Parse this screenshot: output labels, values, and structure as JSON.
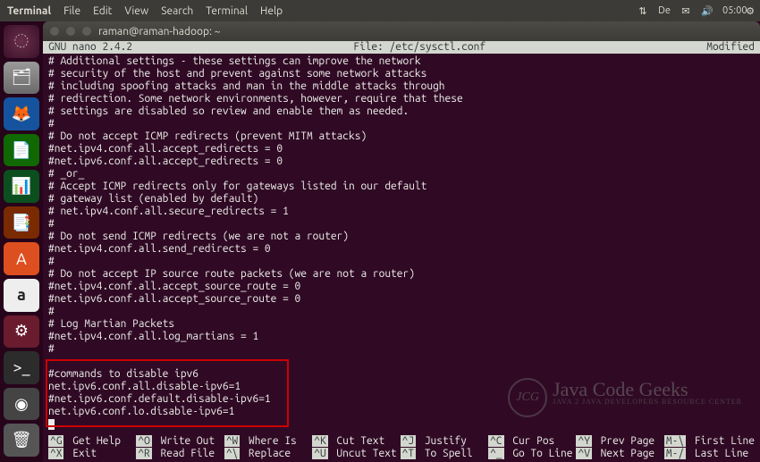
{
  "menubar": {
    "app": "Terminal",
    "items": [
      "File",
      "Edit",
      "View",
      "Search",
      "Terminal",
      "Help"
    ]
  },
  "tray": {
    "kbd": "De",
    "time": "05:00"
  },
  "window": {
    "title": "raman@raman-hadoop: ~"
  },
  "nano": {
    "version": "GNU nano 2.4.2",
    "file_label": "File: /etc/sysctl.conf",
    "status": "Modified"
  },
  "content_lines": [
    "# Additional settings - these settings can improve the network",
    "# security of the host and prevent against some network attacks",
    "# including spoofing attacks and man in the middle attacks through",
    "# redirection. Some network environments, however, require that these",
    "# settings are disabled so review and enable them as needed.",
    "#",
    "# Do not accept ICMP redirects (prevent MITM attacks)",
    "#net.ipv4.conf.all.accept_redirects = 0",
    "#net.ipv6.conf.all.accept_redirects = 0",
    "# _or_",
    "# Accept ICMP redirects only for gateways listed in our default",
    "# gateway list (enabled by default)",
    "# net.ipv4.conf.all.secure_redirects = 1",
    "#",
    "# Do not send ICMP redirects (we are not a router)",
    "#net.ipv4.conf.all.send_redirects = 0",
    "#",
    "# Do not accept IP source route packets (we are not a router)",
    "#net.ipv4.conf.all.accept_source_route = 0",
    "#net.ipv6.conf.all.accept_source_route = 0",
    "#",
    "# Log Martian Packets",
    "#net.ipv4.conf.all.log_martians = 1",
    "#",
    "",
    "#commands to disable ipv6",
    "net.ipv6.conf.all.disable-ipv6=1",
    "#net.ipv6.conf.default.disable-ipv6=1",
    "net.ipv6.conf.lo.disable-ipv6=1"
  ],
  "footer": [
    {
      "key": "^G",
      "label": "Get Help"
    },
    {
      "key": "^O",
      "label": "Write Out"
    },
    {
      "key": "^W",
      "label": "Where Is"
    },
    {
      "key": "^K",
      "label": "Cut Text"
    },
    {
      "key": "^J",
      "label": "Justify"
    },
    {
      "key": "^C",
      "label": "Cur Pos"
    },
    {
      "key": "^X",
      "label": "Exit"
    },
    {
      "key": "^R",
      "label": "Read File"
    },
    {
      "key": "^\\",
      "label": "Replace"
    },
    {
      "key": "^U",
      "label": "Uncut Text"
    },
    {
      "key": "^T",
      "label": "To Spell"
    },
    {
      "key": "^_",
      "label": "Go To Line"
    },
    {
      "key": "^Y",
      "label": "Prev Page"
    },
    {
      "key": "^V",
      "label": "Next Page"
    },
    {
      "key": "M-\\",
      "label": "First Line"
    },
    {
      "key": "M-/",
      "label": "Last Line"
    }
  ],
  "watermark": {
    "main": "Java Code Geeks",
    "sub": "JAVA 2 JAVA DEVELOPERS RESOURCE CENTER",
    "badge": "JCG"
  }
}
